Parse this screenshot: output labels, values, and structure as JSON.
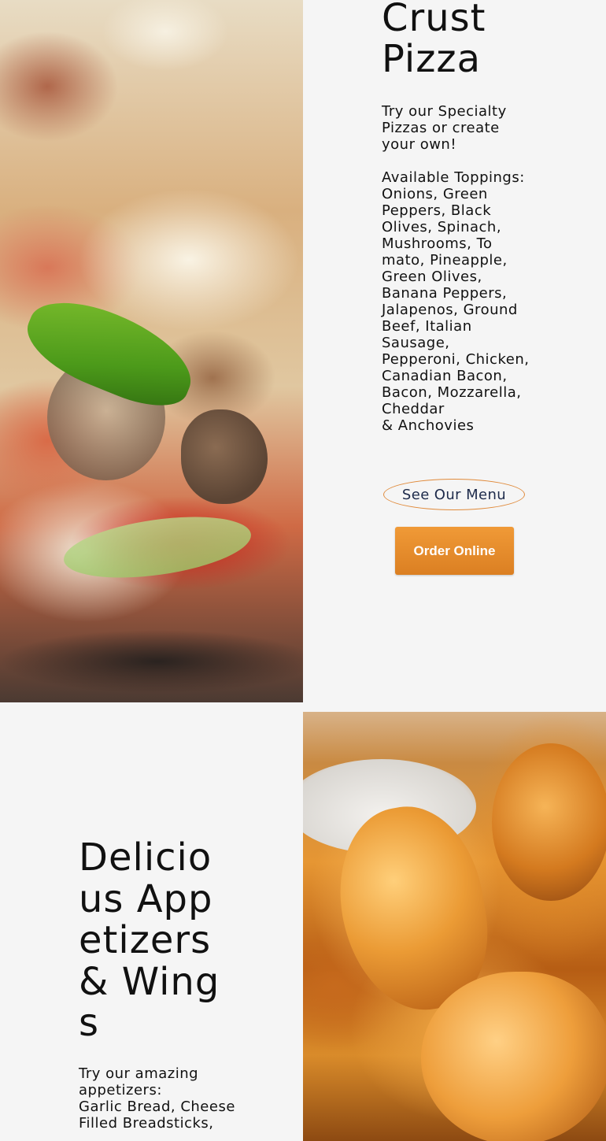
{
  "pizza": {
    "title_line1": "Crust",
    "title_line2": "Pizza",
    "intro": "Try our Specialty Pizzas or create your own!",
    "toppings_label": "Available Toppings:",
    "toppings_list": "Onions, Green Peppers, Black Olives, Spinach, Mushrooms, To mato, Pineapple, Green Olives, Banana Peppers, Jalapenos, Ground Beef, Italian Sausage, Pepperoni, Chicken, Canadian Bacon, Bacon, Mozzarella, Cheddar",
    "toppings_last": "& Anchovies",
    "menu_button_label": "See Our Menu",
    "order_button_label": "Order Online"
  },
  "wings": {
    "title": "Delicious Appetizers & Wings",
    "intro_line1": "Try our amazing appetizers:",
    "intro_line2": "Garlic Bread, Cheese Filled Breadsticks,"
  },
  "colors": {
    "accent_orange": "#e08a3a",
    "button_gradient_top": "#f09a37",
    "button_gradient_bottom": "#db7f22",
    "menu_text": "#1d2a4a",
    "background": "#f5f5f5"
  }
}
